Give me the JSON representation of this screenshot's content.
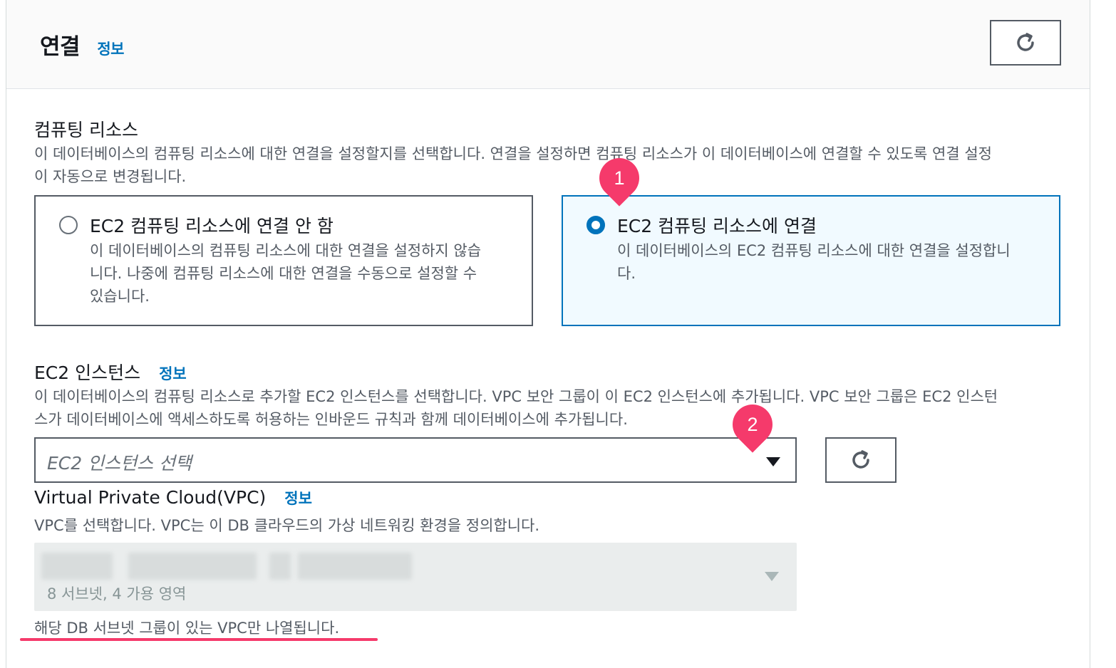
{
  "header": {
    "title": "연결",
    "info_link": "정보"
  },
  "compute": {
    "label": "컴퓨팅 리소스",
    "desc_line1": "이 데이터베이스의 컴퓨팅 리소스에 대한 연결을 설정할지를 선택합니다. 연결을 설정하면 컴퓨팅 리소스가 이 데이터베이스에 연결할 수 있도록 연결 설정",
    "desc_line2": "이 자동으로 변경됩니다.",
    "options": [
      {
        "title": "EC2 컴퓨팅 리소스에 연결 안 함",
        "desc_lines": [
          "이 데이터베이스의 컴퓨팅 리소스에 대한 연결을 설정하지 않습",
          "니다. 나중에 컴퓨팅 리소스에 대한 연결을 수동으로 설정할 수",
          "있습니다."
        ],
        "selected": false
      },
      {
        "title": "EC2 컴퓨팅 리소스에 연결",
        "desc_lines": [
          "이 데이터베이스의 EC2 컴퓨팅 리소스에 대한 연결을 설정합니",
          "다."
        ],
        "selected": true
      }
    ]
  },
  "ec2": {
    "label": "EC2 인스턴스",
    "info_link": "정보",
    "desc_line1": "이 데이터베이스의 컴퓨팅 리소스로 추가할 EC2 인스턴스를 선택합니다. VPC 보안 그룹이 이 EC2 인스턴스에 추가됩니다. VPC 보안 그룹은 EC2 인스턴",
    "desc_line2": "스가 데이터베이스에 액세스하도록 허용하는 인바운드 규칙과 함께 데이터베이스에 추가됩니다.",
    "select_placeholder": "EC2 인스턴스 선택"
  },
  "vpc": {
    "label": "Virtual Private Cloud(VPC)",
    "info_link": "정보",
    "desc": "VPC를 선택합니다. VPC는 이 DB 클라우드의 가상 네트워킹 환경을 정의합니다.",
    "select_subtext": "8 서브넷, 4 가용 영역",
    "hint": "해당 DB 서브넷 그룹이 있는 VPC만 나열됩니다."
  },
  "annotations": {
    "badge1": "1",
    "badge2": "2",
    "color": "#f53a6b"
  },
  "icons": {
    "refresh": "refresh-icon",
    "dropdown": "caret-down-icon"
  },
  "colors": {
    "accent": "#0073bb",
    "selected_tile_bg": "#f1faff",
    "annotation": "#f53a6b"
  }
}
